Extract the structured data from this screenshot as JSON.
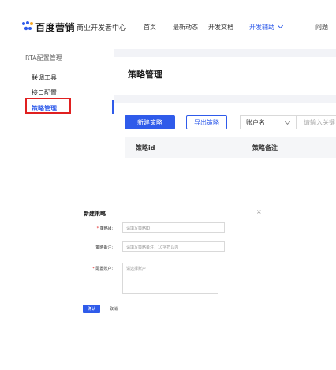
{
  "nav": {
    "brand": "百度营销",
    "brand_sub": "商业开发者中心",
    "items": [
      {
        "label": "首页"
      },
      {
        "label": "最新动态"
      },
      {
        "label": "开发文档"
      },
      {
        "label": "开发辅助"
      },
      {
        "label": "问题"
      }
    ]
  },
  "sidebar": {
    "group": "RTA配置管理",
    "items": [
      {
        "label": "联调工具"
      },
      {
        "label": "接口配置"
      },
      {
        "label": "策略管理"
      }
    ]
  },
  "main": {
    "title": "策略管理",
    "new_button": "新建策略",
    "export_button": "导出策略",
    "select_value": "账户名",
    "search_placeholder": "请输入关键",
    "columns": [
      "策略id",
      "策略备注"
    ]
  },
  "dialog": {
    "title": "新建策略",
    "close": "×",
    "fields": [
      {
        "label": "策略id:",
        "required": true,
        "placeholder": "请填写策略ID"
      },
      {
        "label": "策略备注:",
        "required": false,
        "placeholder": "请填写策略备注，10字符以内"
      },
      {
        "label": "配置账户:",
        "required": true,
        "placeholder": "请选择账户"
      }
    ],
    "ok": "确认",
    "cancel": "取消"
  },
  "colors": {
    "accent": "#2f5bea",
    "highlight": "#e02020",
    "panel_bg": "#f2f3f7"
  }
}
